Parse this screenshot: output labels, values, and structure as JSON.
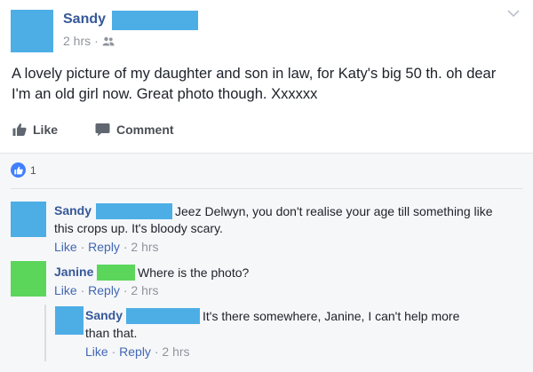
{
  "post": {
    "author": "Sandy",
    "time": "2 hrs",
    "separator": "·",
    "text": "A lovely picture of my daughter and son in law, for Katy's big 50 th. oh dear I'm an old girl now. Great photo though. Xxxxxx",
    "like_label": "Like",
    "comment_label": "Comment",
    "like_count": "1"
  },
  "comments": [
    {
      "author": "Sandy",
      "text_line1": "Jeez Delwyn, you don't realise your age till something like",
      "text_line2": "this crops up. It's bloody scary.",
      "like": "Like",
      "reply": "Reply",
      "time": "2 hrs"
    },
    {
      "author": "Janine",
      "text_line1": "Where is the photo?",
      "like": "Like",
      "reply": "Reply",
      "time": "2 hrs"
    },
    {
      "author": "Sandy",
      "text_line1": "It's there somewhere, Janine, I can't help more",
      "text_line2": "than that.",
      "like": "Like",
      "reply": "Reply",
      "time": "2 hrs"
    }
  ],
  "colors": {
    "redaction_blue": "#4daee6",
    "redaction_green": "#5bd65b",
    "link": "#365899",
    "like_blue": "#4080ff"
  },
  "icons": {
    "audience": "friends-icon",
    "options": "chevron-down-icon",
    "like": "thumbs-up-icon",
    "comment": "comment-bubble-icon"
  }
}
